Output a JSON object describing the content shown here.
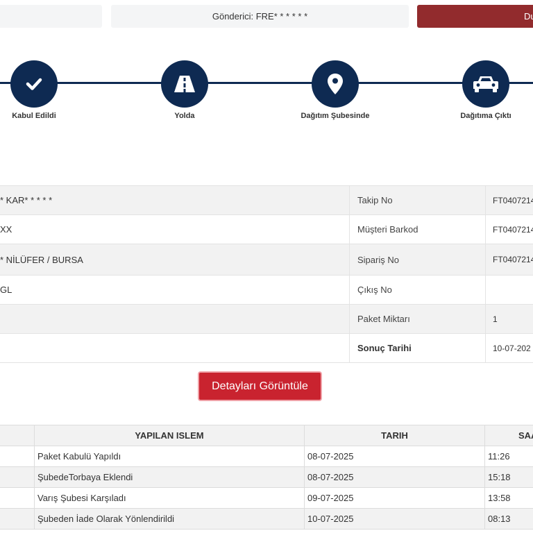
{
  "top": {
    "sender_label": "Gönderici: FRE* * * * * *",
    "action_label": "Du"
  },
  "progress": {
    "steps": [
      {
        "label": "Kabul Edildi",
        "icon": "check-icon"
      },
      {
        "label": "Yolda",
        "icon": "road-icon"
      },
      {
        "label": "Dağıtım Şubesinde",
        "icon": "map-pin-icon"
      },
      {
        "label": "Dağıtıma Çıktı",
        "icon": "car-icon"
      }
    ]
  },
  "info": {
    "rows": [
      {
        "left": "* KAR* * * * *",
        "label": "Takip No",
        "value": "FT0407214"
      },
      {
        "left": "XX",
        "label": "Müşteri Barkod",
        "value": "FT0407214"
      },
      {
        "left": "* NİLÜFER / BURSA",
        "label": "Sipariş No",
        "value": "FT0407214"
      },
      {
        "left": "GL",
        "label": "Çıkış No",
        "value": ""
      },
      {
        "left": "",
        "label": "Paket Miktarı",
        "value": "1"
      },
      {
        "left": "",
        "label": "Sonuç Tarihi",
        "value": "10-07-202"
      }
    ]
  },
  "details_button": "Detayları Görüntüle",
  "history": {
    "headers": [
      "",
      "YAPILAN ISLEM",
      "TARIH",
      "SAA"
    ],
    "rows": [
      {
        "islem": "Paket Kabulü Yapıldı",
        "tarih": "08-07-2025",
        "saat": "11:26"
      },
      {
        "islem": "ŞubedeTorbaya Eklendi",
        "tarih": "08-07-2025",
        "saat": "15:18"
      },
      {
        "islem": "Varış Şubesi Karşıladı",
        "tarih": "09-07-2025",
        "saat": "13:58"
      },
      {
        "islem": "Şubeden İade Olarak Yönlendirildi",
        "tarih": "10-07-2025",
        "saat": "08:13"
      }
    ]
  },
  "colors": {
    "navy": "#0e2a52",
    "red": "#c9232f",
    "dark_red": "#922b2d"
  }
}
